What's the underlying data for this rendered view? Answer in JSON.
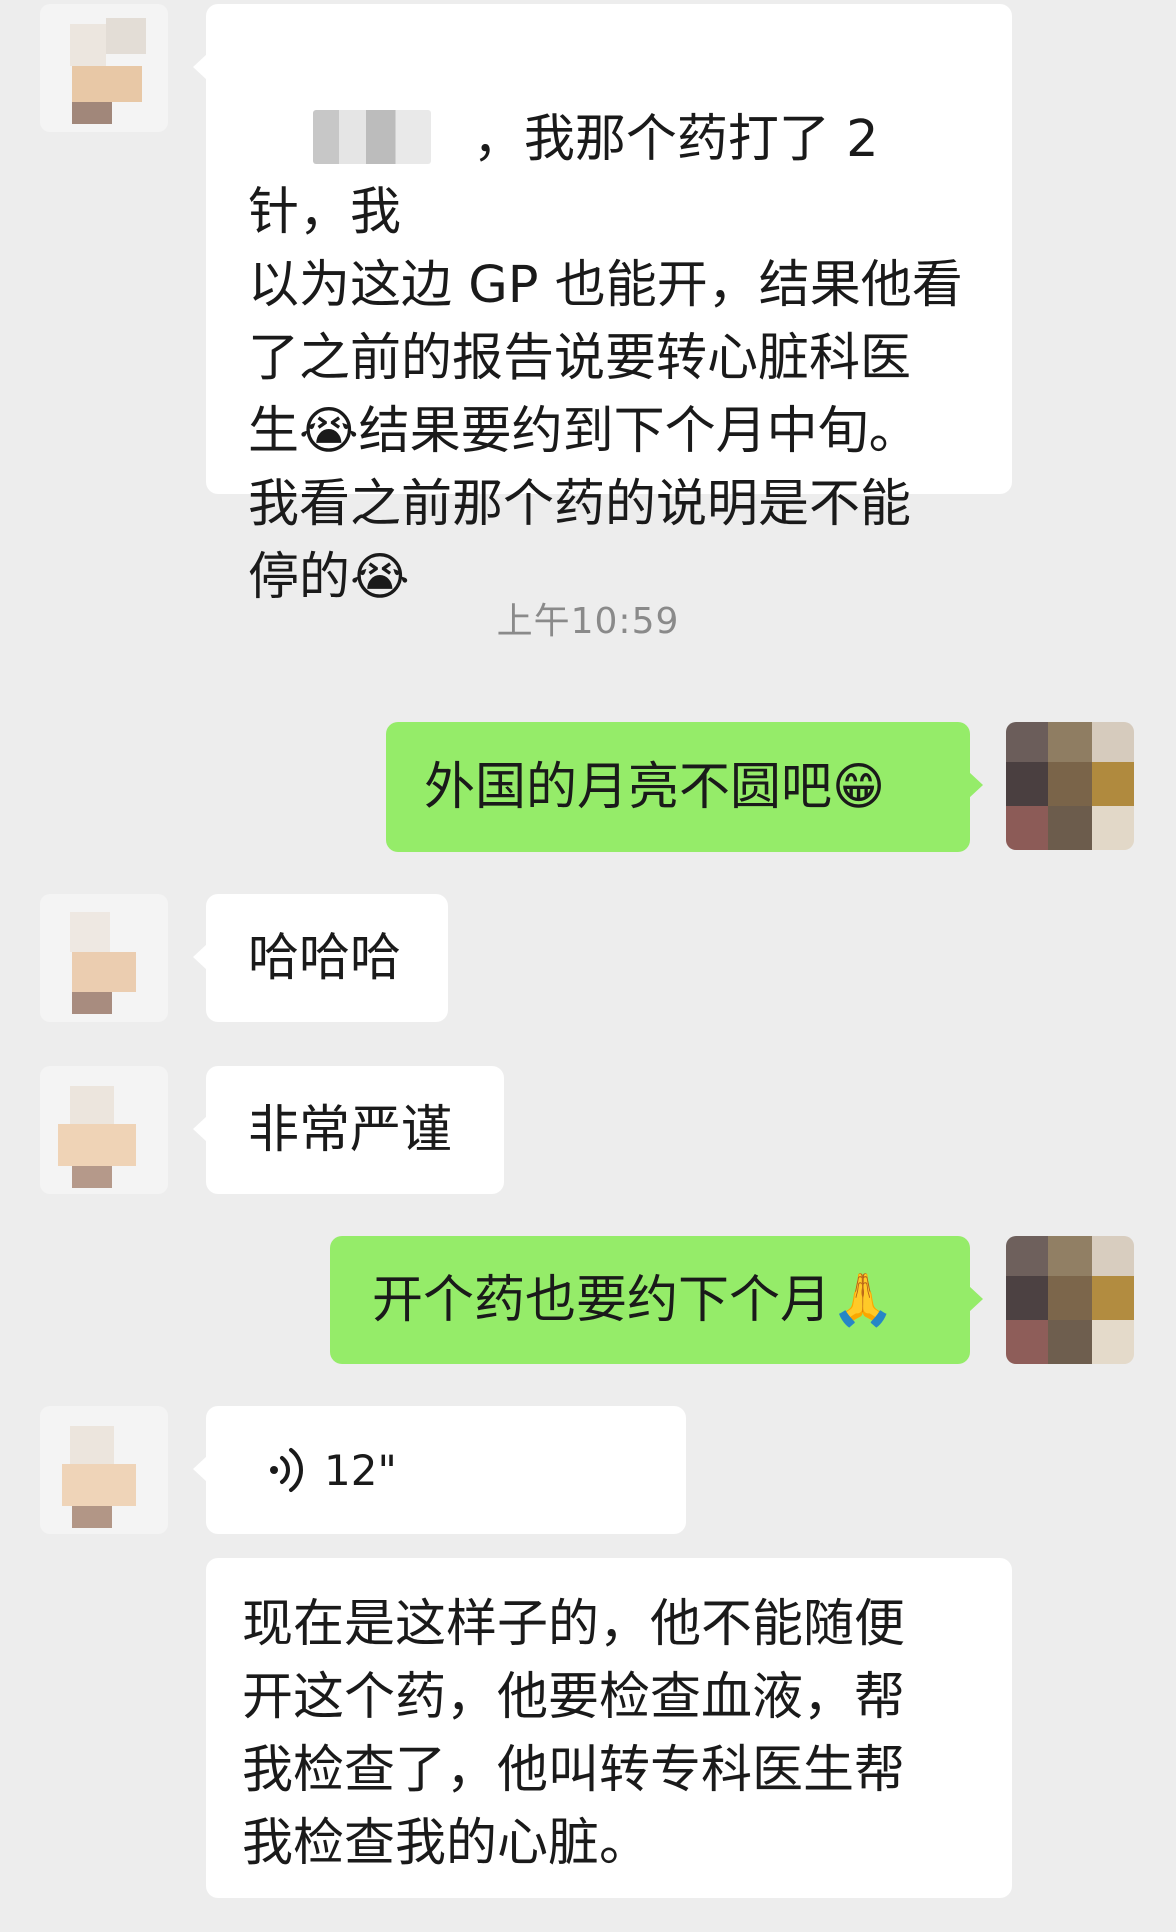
{
  "chat": {
    "timestamp": "上午10:59",
    "messages": [
      {
        "side": "left",
        "redacted_prefix": true,
        "text": "我那个药打了2针，我以为这边GP也能开，结果他看了之前的报告说要转心脏科医生😭结果要约到下个月中旬。我看之前那个药的说明是不能停的😭"
      },
      {
        "side": "right",
        "text": "外国的月亮不圆吧😁"
      },
      {
        "side": "left",
        "text": "哈哈哈"
      },
      {
        "side": "left",
        "text": "非常严谨"
      },
      {
        "side": "right",
        "text": "开个药也要约下个月🙏"
      },
      {
        "side": "left",
        "type": "voice",
        "duration": "12\""
      },
      {
        "side": "left",
        "type": "transcript",
        "text": "现在是这样子的，他不能随便开这个药，他要检查血液，帮我检查了，他叫转专科医生帮我检查我的心脏。"
      }
    ]
  },
  "lines": {
    "m1": [
      "，我那个药打了 2 针，我",
      "以为这边 GP 也能开，结果他看",
      "了之前的报告说要转心脏科医",
      "生😭结果要约到下个月中旬。",
      "我看之前那个药的说明是不能",
      "停的😭"
    ],
    "m7": [
      "现在是这样子的，他不能随便",
      "开这个药，他要检查血液，帮",
      "我检查了，他叫转专科医生帮",
      "我检查我的心脏。"
    ]
  },
  "icons": {
    "voice": "voice-wave-icon",
    "avatar_self": "avatar-self",
    "avatar_other": "avatar-other"
  },
  "colors": {
    "background": "#ededed",
    "incoming_bubble": "#ffffff",
    "outgoing_bubble": "#95ec69",
    "timestamp_text": "#8a8a8a"
  }
}
